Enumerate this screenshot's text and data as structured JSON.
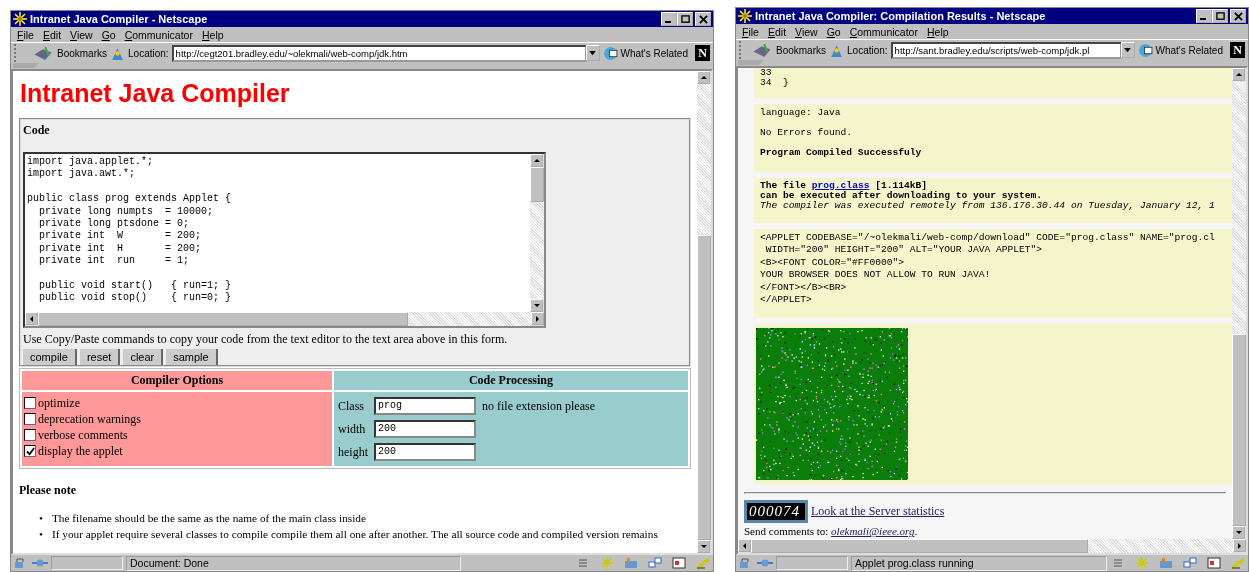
{
  "left_window": {
    "title": "Intranet Java Compiler - Netscape",
    "menu": [
      "File",
      "Edit",
      "View",
      "Go",
      "Communicator",
      "Help"
    ],
    "bookmarks": "Bookmarks",
    "location_label": "Location:",
    "url": "http://cegt201.bradley.edu/~olekmali/web-comp/jdk.htm",
    "whats_related": "What's Related",
    "logo": "N",
    "status": "Document: Done"
  },
  "compiler_page": {
    "heading": "Intranet Java Compiler",
    "code_label": "Code",
    "code_blocks": [
      [
        "import java.applet.*;",
        "import java.awt.*;"
      ],
      [
        "public class prog extends Applet {",
        "  private long numpts  = 10000;",
        "  private long ptsdone = 0;",
        "  private int  W       = 200;",
        "  private int  H       = 200;",
        "  private int  run     = 1;"
      ],
      [
        "  public void start()   { run=1; }",
        "  public void stop()    { run=0; }"
      ]
    ],
    "hint": "Use Copy/Paste commands to copy your code from the text editor to the text area above in this form.",
    "buttons": [
      "compile",
      "reset",
      "clear",
      "sample"
    ],
    "options_header": "Compiler Options",
    "options": [
      {
        "label": "optimize",
        "checked": false
      },
      {
        "label": "deprecation warnings",
        "checked": false
      },
      {
        "label": "verbose comments",
        "checked": false
      },
      {
        "label": "display the applet",
        "checked": true
      }
    ],
    "processing_header": "Code Processing",
    "fields": [
      {
        "label": "Class",
        "value": "prog",
        "note": "no file extension please"
      },
      {
        "label": "width",
        "value": "200"
      },
      {
        "label": "height",
        "value": "200"
      }
    ],
    "note_title": "Please note",
    "notes": [
      {
        "marker": "•",
        "text": "The filename should be the same as the name of the main class inside"
      },
      {
        "marker": "•",
        "text": "If your applet require several classes to compile compile them all one after another. The all source code and compiled version remains"
      }
    ]
  },
  "right_window": {
    "title": "Intranet Java Compiler: Compilation Results - Netscape",
    "menu": [
      "File",
      "Edit",
      "View",
      "Go",
      "Communicator",
      "Help"
    ],
    "bookmarks": "Bookmarks",
    "location_label": "Location:",
    "url": "http://sant.bradley.edu/scripts/web-comp/jdk.pl",
    "whats_related": "What's Related",
    "logo": "N",
    "status": "Applet prog.class running"
  },
  "results_page": {
    "listing_lines": [
      "33",
      "34  }"
    ],
    "language": "language: Java",
    "errors": "No Errors found.",
    "result": "Program Compiled Successfuly",
    "file_prefix": "The file",
    "file_link": "prog.class",
    "file_size": "[1.114kB]",
    "file_note": "can be executed after downloading to your system.",
    "remote_note": "The compiler was executed remotely from 136.176.30.44 on Tuesday, January 12, 1",
    "applet_lines": [
      "<APPLET CODEBASE=\"/~olekmali/web-comp/download\" CODE=\"prog.class\" NAME=\"prog.cl",
      " WIDTH=\"200\" HEIGHT=\"200\" ALT=\"YOUR JAVA APPLET\">",
      "<B><FONT COLOR=\"#FF0000\">",
      "YOUR BROWSER DOES NOT ALLOW TO RUN JAVA!",
      "</FONT></B><BR>",
      "</APPLET>"
    ],
    "counter": "000074",
    "stats_link": "Look at the Server statistics",
    "comments_label": "Send comments to:",
    "email": "olekmali@ieee.org",
    "email_end": "."
  }
}
